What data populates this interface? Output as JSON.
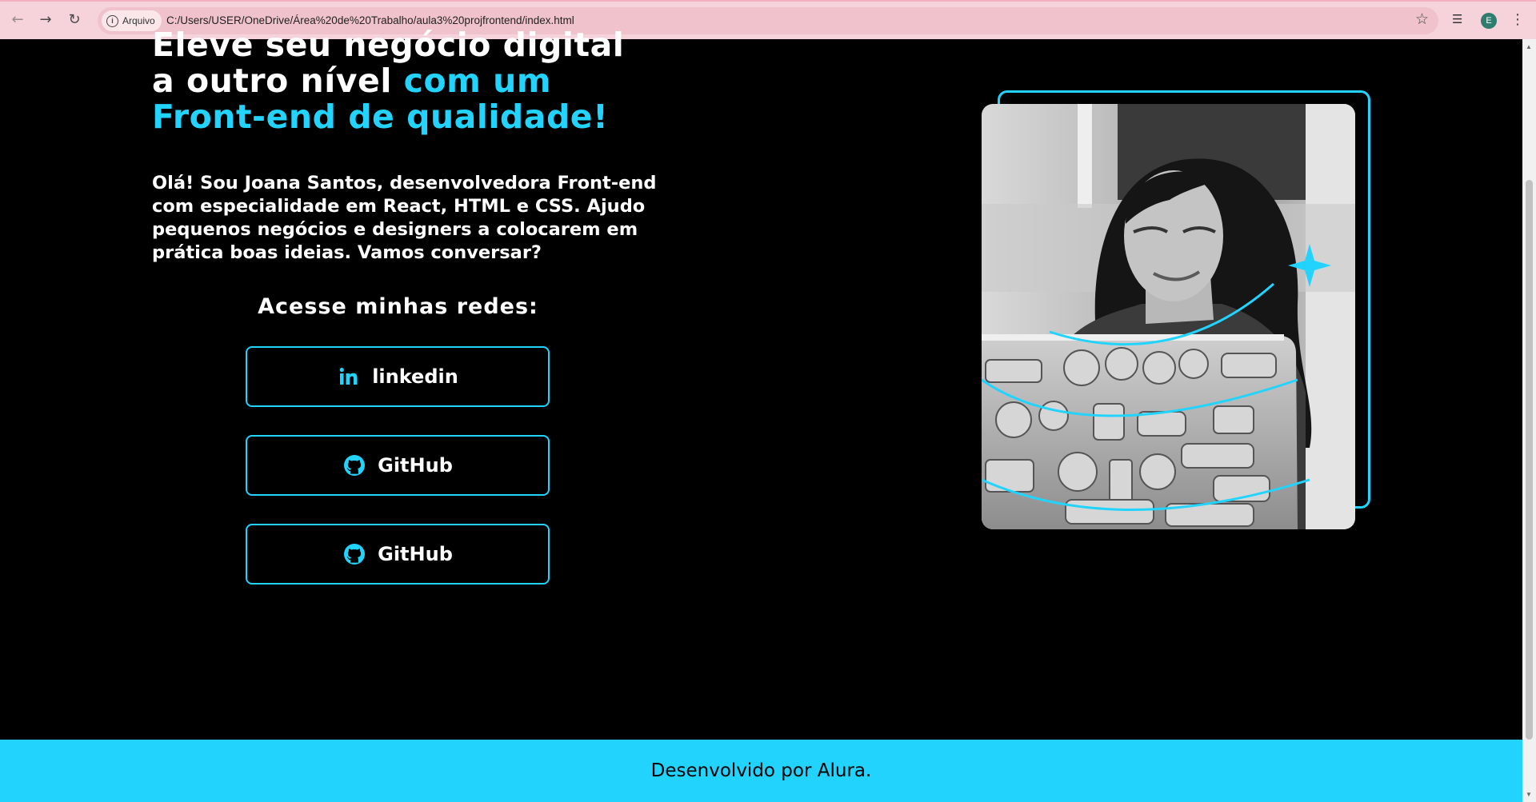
{
  "browser": {
    "back_icon": "arrow-left-icon",
    "forward_icon": "arrow-right-icon",
    "reload_icon": "reload-icon",
    "site_chip_label": "Arquivo",
    "url": "C:/Users/USER/OneDrive/Área%20de%20Trabalho/aula3%20projfrontend/index.html",
    "profile_initial": "E"
  },
  "hero": {
    "headline_line1": "Eleve seu negócio digital",
    "headline_line2_white": "a outro nível ",
    "headline_line2_accent": "com um",
    "headline_line3_accent": "Front-end de qualidade!",
    "bio": "Olá! Sou Joana Santos, desenvolvedora Front-end com especialidade em React, HTML e CSS. Ajudo pequenos negócios e designers a colocarem em prática boas ideias. Vamos conversar?"
  },
  "links": {
    "title": "Acesse minhas redes:",
    "items": [
      {
        "label": "linkedin",
        "icon": "linkedin-icon"
      },
      {
        "label": "GitHub",
        "icon": "github-icon"
      },
      {
        "label": "GitHub",
        "icon": "github-icon"
      }
    ]
  },
  "footer": {
    "text": "Desenvolvido por Alura."
  },
  "colors": {
    "accent": "#22d4fd",
    "background": "#000000",
    "chrome": "#f6d3da"
  }
}
